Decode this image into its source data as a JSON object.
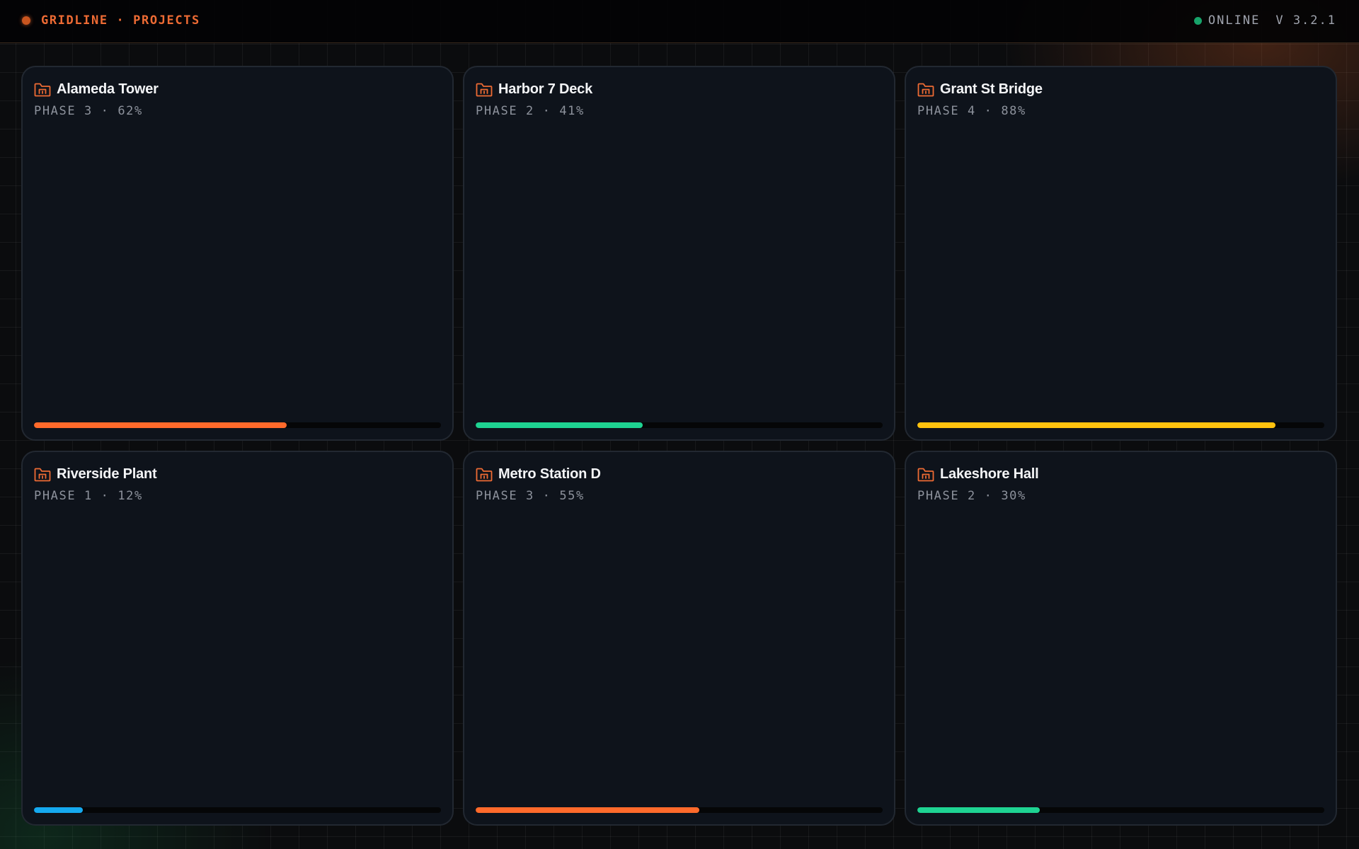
{
  "header": {
    "brand": "GRIDLINE · PROJECTS",
    "status": "ONLINE",
    "version": "V 3.2.1"
  },
  "colors": {
    "accent": "#ee6b34",
    "online": "#17a36a"
  },
  "projects": [
    {
      "name": "Alameda Tower",
      "meta": "PHASE 3 · 62%",
      "progress": 0.62,
      "color": "#ff6a2b",
      "icon": "folder-icon"
    },
    {
      "name": "Harbor 7 Deck",
      "meta": "PHASE 2 · 41%",
      "progress": 0.41,
      "color": "#1ed392",
      "icon": "folder-icon"
    },
    {
      "name": "Grant St Bridge",
      "meta": "PHASE 4 · 88%",
      "progress": 0.88,
      "color": "#ffc20e",
      "icon": "folder-icon"
    },
    {
      "name": "Riverside Plant",
      "meta": "PHASE 1 · 12%",
      "progress": 0.12,
      "color": "#15a9ef",
      "icon": "folder-icon"
    },
    {
      "name": "Metro Station D",
      "meta": "PHASE 3 · 55%",
      "progress": 0.55,
      "color": "#ff6a2b",
      "icon": "folder-icon"
    },
    {
      "name": "Lakeshore Hall",
      "meta": "PHASE 2 · 30%",
      "progress": 0.3,
      "color": "#1ed392",
      "icon": "folder-icon"
    }
  ]
}
